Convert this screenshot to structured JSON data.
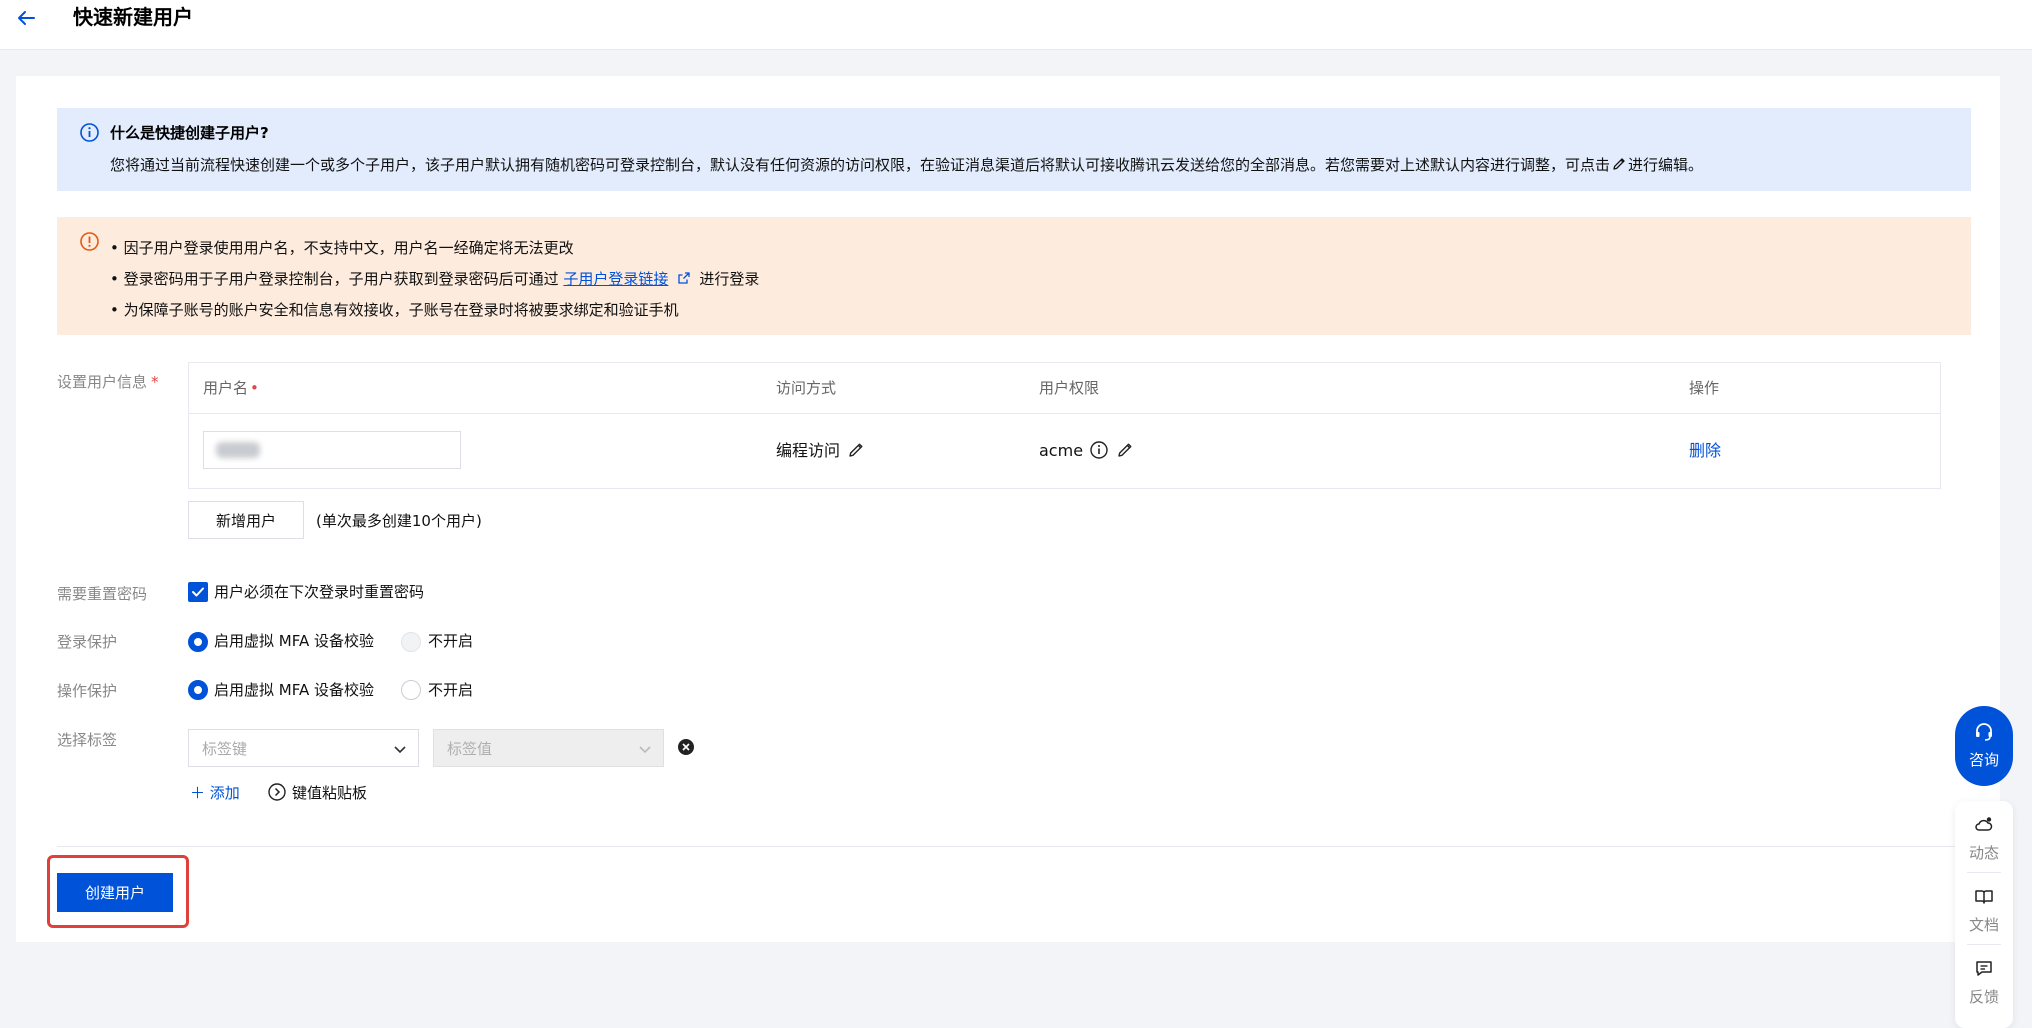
{
  "header": {
    "title": "快速新建用户"
  },
  "info_box": {
    "title": "什么是快捷创建子用户?",
    "body_before": "您将通过当前流程快速创建一个或多个子用户，该子用户默认拥有随机密码可登录控制台，默认没有任何资源的访问权限，在验证消息渠道后将默认可接收腾讯云发送给您的全部消息。若您需要对上述默认内容进行调整，可点击",
    "body_after": "进行编辑。"
  },
  "warn_box": {
    "line1": "• 因子用户登录使用用户名，不支持中文，用户名一经确定将无法更改",
    "line2_before": "• 登录密码用于子用户登录控制台，子用户获取到登录密码后可通过",
    "line2_link": "子用户登录链接",
    "line2_after": "进行登录",
    "line3": "• 为保障子账号的账户安全和信息有效接收，子账号在登录时将被要求绑定和验证手机"
  },
  "form": {
    "user_info_label": "设置用户信息",
    "required_mark": "*",
    "table": {
      "headers": {
        "username": "用户名",
        "access": "访问方式",
        "permission": "用户权限",
        "action": "操作"
      },
      "header_required_dot": "•",
      "row": {
        "access": "编程访问",
        "permission": "acme",
        "action": "删除"
      }
    },
    "add_user_button": "新增用户",
    "add_user_hint": "(单次最多创建10个用户)",
    "reset_password": {
      "label": "需要重置密码",
      "option": "用户必须在下次登录时重置密码",
      "checked": true
    },
    "login_protect": {
      "label": "登录保护",
      "option_on": "启用虚拟 MFA 设备校验",
      "option_off": "不开启",
      "selected": "on"
    },
    "op_protect": {
      "label": "操作保护",
      "option_on": "启用虚拟 MFA 设备校验",
      "option_off": "不开启",
      "selected": "on"
    },
    "tags": {
      "label": "选择标签",
      "key_placeholder": "标签键",
      "value_placeholder": "标签值",
      "add_label": "添加",
      "paste_label": "键值粘贴板"
    },
    "submit_button": "创建用户"
  },
  "side": {
    "consult": "咨询",
    "tools": [
      {
        "label": "动态"
      },
      {
        "label": "文档"
      },
      {
        "label": "反馈"
      }
    ]
  },
  "colors": {
    "brand": "#0052d9",
    "info_bg": "#e2ecfd",
    "warn_bg": "#fdebde",
    "danger": "#e54545",
    "highlight": "#e0403a"
  }
}
